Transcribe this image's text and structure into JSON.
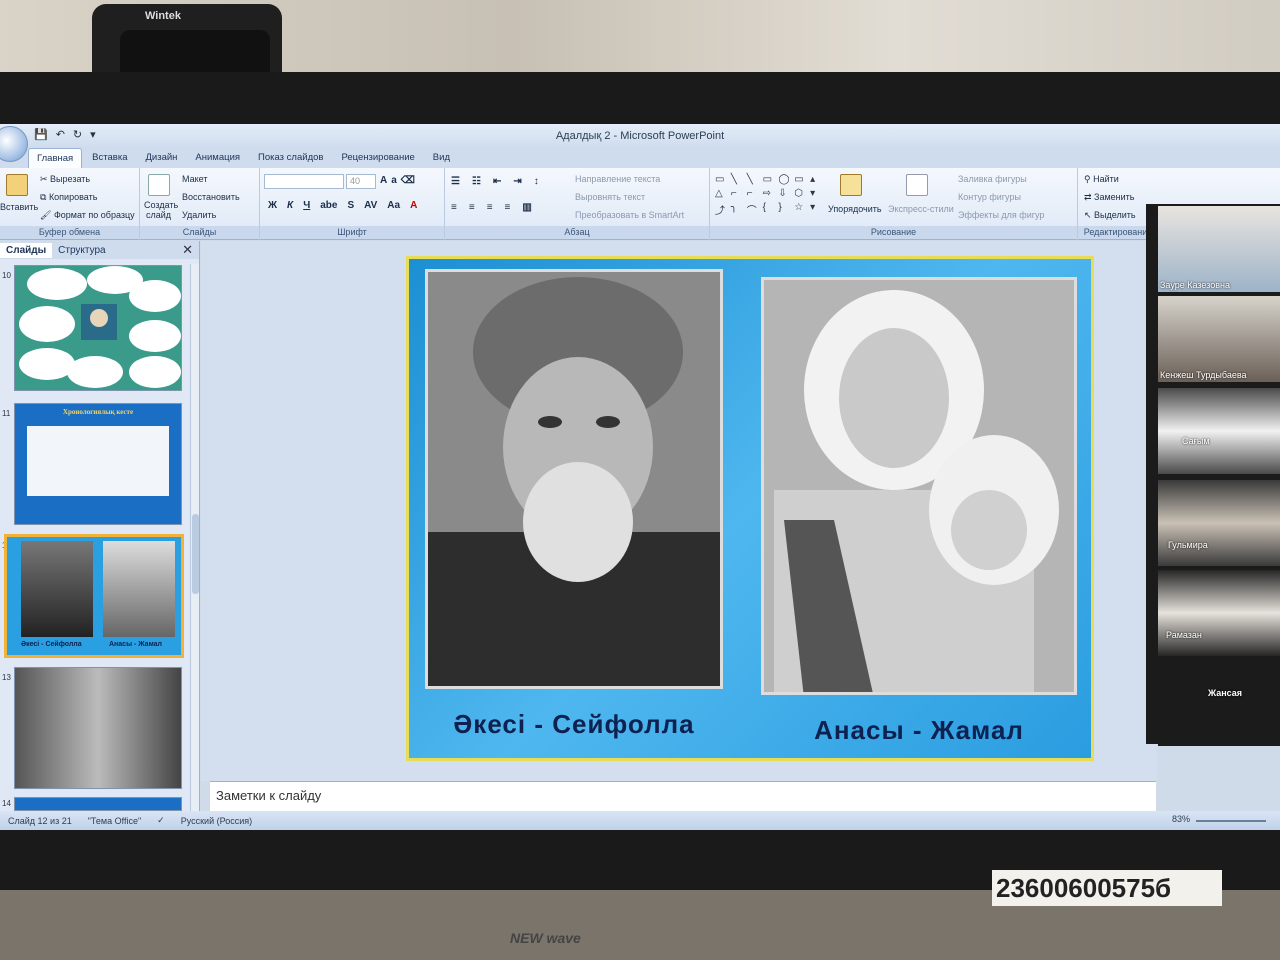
{
  "physical": {
    "webcam_brand": "Wintek",
    "sticker_number": "23600600575б",
    "speaker_label": "NEW wave"
  },
  "window": {
    "title": "Адалдық 2 - Microsoft PowerPoint"
  },
  "tabs": [
    "Главная",
    "Вставка",
    "Дизайн",
    "Анимация",
    "Показ слайдов",
    "Рецензирование",
    "Вид"
  ],
  "ribbon": {
    "clipboard": {
      "paste": "Вставить",
      "cut": "Вырезать",
      "copy": "Копировать",
      "format_painter": "Формат по образцу",
      "label": "Буфер обмена"
    },
    "slides": {
      "new_slide_1": "Создать",
      "new_slide_2": "слайд",
      "layout": "Макет",
      "reset": "Восстановить",
      "delete": "Удалить",
      "label": "Слайды"
    },
    "font": {
      "size": "40",
      "label": "Шрифт"
    },
    "paragraph": {
      "text_direction": "Направление текста",
      "align_text": "Выровнять текст",
      "smartart": "Преобразовать в SmartArt",
      "label": "Абзац"
    },
    "drawing": {
      "arrange": "Упорядочить",
      "quick_styles": "Экспресс-стили",
      "shape_fill": "Заливка фигуры",
      "shape_outline": "Контур фигуры",
      "shape_effects": "Эффекты для фигур",
      "label": "Рисование"
    },
    "editing": {
      "find": "Найти",
      "replace": "Заменить",
      "select": "Выделить",
      "label": "Редактирование"
    }
  },
  "panel": {
    "tab_slides": "Слайды",
    "tab_outline": "Структура",
    "thumbnails": [
      {
        "num": "10"
      },
      {
        "num": "11",
        "title": "Хронологиялық кесте"
      },
      {
        "num": "12",
        "caption_left": "Әкесі - Сейфолла",
        "caption_right": "Анасы - Жамал"
      },
      {
        "num": "13"
      },
      {
        "num": "14"
      }
    ]
  },
  "slide": {
    "caption_left": "Әкесі - Сейфолла",
    "caption_right": "Анасы  - Жамал"
  },
  "notes_placeholder": "Заметки к слайду",
  "status": {
    "slide_info": "Слайд 12 из 21",
    "theme": "\"Тема Office\"",
    "language": "Русский (Россия)",
    "zoom": "83%"
  },
  "participants": [
    {
      "name": "Зауре Казезовна"
    },
    {
      "name": "Кенжеш Турдыбаева"
    },
    {
      "name": "Сағым"
    },
    {
      "name": "Гульмира"
    },
    {
      "name": "Рамазан"
    },
    {
      "name": "Жансая"
    }
  ]
}
